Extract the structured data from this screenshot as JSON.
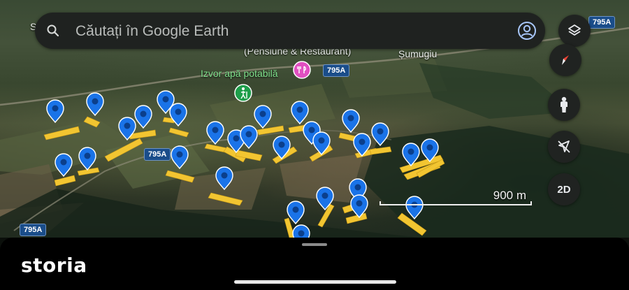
{
  "search": {
    "placeholder": "Căutați în Google Earth"
  },
  "labels": {
    "top_left_fragment": "S",
    "guesthouse": "(Pensiune & Restaurant)",
    "village": "Șumugiu",
    "spring": "Izvor apă potabilă"
  },
  "roads": {
    "r1": "795A",
    "r2": "795A",
    "r3": "795A",
    "r4": "795A"
  },
  "controls": {
    "view_mode": "2D"
  },
  "scale": {
    "text": "900 m"
  },
  "brand": "storia",
  "colors": {
    "pin": "#1a73e8",
    "parcel": "#f2c531",
    "poi_pink": "#e14fc1",
    "poi_green": "#1e9e4a"
  },
  "icons": [
    "search-icon",
    "account-icon",
    "layers-icon",
    "compass-icon",
    "street-view-icon",
    "location-off-icon"
  ]
}
